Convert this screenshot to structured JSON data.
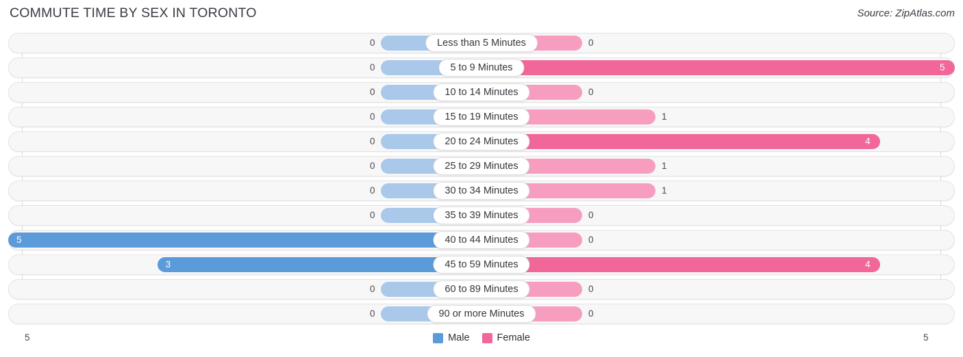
{
  "header": {
    "title": "COMMUTE TIME BY SEX IN TORONTO",
    "source": "Source: ZipAtlas.com"
  },
  "legend": {
    "male_label": "Male",
    "female_label": "Female"
  },
  "axis": {
    "left_tick": "5",
    "right_tick": "5"
  },
  "colors": {
    "male": "#5b9bd9",
    "male_light": "#a9c8ea",
    "female": "#f1679a",
    "female_light": "#f79ec0",
    "track": "#f7f7f7",
    "track_border": "#e3e3e3",
    "gridline": "#d8d8d8",
    "text": "#3a3a44"
  },
  "chart_data": {
    "type": "bar",
    "orientation": "horizontal-diverging",
    "title": "COMMUTE TIME BY SEX IN TORONTO",
    "xlabel": "",
    "ylabel": "",
    "xlim": [
      5,
      5
    ],
    "grid": true,
    "legend_position": "bottom-center",
    "categories": [
      "Less than 5 Minutes",
      "5 to 9 Minutes",
      "10 to 14 Minutes",
      "15 to 19 Minutes",
      "20 to 24 Minutes",
      "25 to 29 Minutes",
      "30 to 34 Minutes",
      "35 to 39 Minutes",
      "40 to 44 Minutes",
      "45 to 59 Minutes",
      "60 to 89 Minutes",
      "90 or more Minutes"
    ],
    "series": [
      {
        "name": "Male",
        "color": "#5b9bd9",
        "values": [
          0,
          0,
          0,
          0,
          0,
          0,
          0,
          0,
          5,
          3,
          0,
          0
        ],
        "labels": [
          "0",
          "0",
          "0",
          "0",
          "0",
          "0",
          "0",
          "0",
          "5",
          "3",
          "0",
          "0"
        ]
      },
      {
        "name": "Female",
        "color": "#f1679a",
        "values": [
          0,
          5,
          0,
          1,
          4,
          1,
          1,
          0,
          0,
          4,
          0,
          0
        ],
        "labels": [
          "0",
          "5",
          "0",
          "1",
          "4",
          "1",
          "1",
          "0",
          "0",
          "4",
          "0",
          "0"
        ]
      }
    ]
  }
}
